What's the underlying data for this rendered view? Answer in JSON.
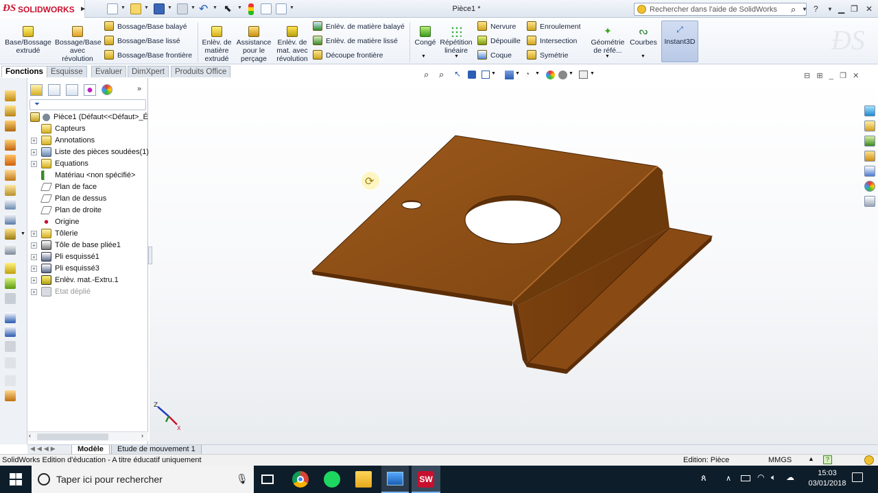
{
  "app": {
    "brand": "SOLIDWORKS",
    "document_title": "Pièce1 *"
  },
  "search": {
    "placeholder": "Rechercher dans l'aide de SolidWorks"
  },
  "ribbon": {
    "large_buttons": [
      {
        "label": "Base/Bossage extrudé"
      },
      {
        "label": "Bossage/Base avec révolution"
      },
      {
        "label": "Enlèv. de matière extrudé"
      },
      {
        "label": "Assistance pour le perçage"
      },
      {
        "label": "Enlèv. de mat. avec révolution"
      },
      {
        "label": "Congé"
      },
      {
        "label": "Répétition linéaire"
      },
      {
        "label": "Géométrie de réfé..."
      },
      {
        "label": "Courbes"
      },
      {
        "label": "Instant3D"
      }
    ],
    "stack1": [
      "Bossage/Base balayé",
      "Bossage/Base lissé",
      "Bossage/Base frontière"
    ],
    "stack2": [
      "Enlèv. de matière balayé",
      "Enlèv. de matière lissé",
      "Découpe frontière"
    ],
    "stack3": [
      "Nervure",
      "Dépouille",
      "Coque"
    ],
    "stack4": [
      "Enroulement",
      "Intersection",
      "Symétrie"
    ]
  },
  "tabs": [
    "Fonctions",
    "Esquisse",
    "Evaluer",
    "DimXpert",
    "Produits Office"
  ],
  "tree": {
    "root": "Pièce1  (Défaut<<Défaut>_É",
    "items": [
      {
        "label": "Capteurs",
        "expand": false
      },
      {
        "label": "Annotations",
        "expand": true
      },
      {
        "label": "Liste des pièces soudées(1)",
        "expand": true
      },
      {
        "label": "Equations",
        "expand": true
      },
      {
        "label": "Matériau <non spécifié>",
        "expand": false
      },
      {
        "label": "Plan de face",
        "expand": false
      },
      {
        "label": "Plan de dessus",
        "expand": false
      },
      {
        "label": "Plan de droite",
        "expand": false
      },
      {
        "label": "Origine",
        "expand": false
      },
      {
        "label": "Tôlerie",
        "expand": true
      },
      {
        "label": "Tôle de base pliée1",
        "expand": true
      },
      {
        "label": "Pli esquissé1",
        "expand": true
      },
      {
        "label": "Pli esquissé3",
        "expand": true
      },
      {
        "label": "Enlèv. mat.-Extru.1",
        "expand": true
      },
      {
        "label": "Etat déplié",
        "expand": true,
        "dim": true
      }
    ]
  },
  "bottom_tabs": [
    "Modèle",
    "Etude de mouvement 1"
  ],
  "status": {
    "left": "SolidWorks Edition d'éducation - A titre éducatif uniquement",
    "edition": "Edition: Pièce",
    "units": "MMGS"
  },
  "triad": {
    "z": "Z",
    "x": "X"
  },
  "taskbar": {
    "search_placeholder": "Taper ici pour rechercher",
    "time": "15:03",
    "date": "03/01/2018"
  },
  "colors": {
    "part": "#8a4a14",
    "part_light": "#a85d1e",
    "part_dark": "#5e3009",
    "accent": "#c8102e"
  }
}
